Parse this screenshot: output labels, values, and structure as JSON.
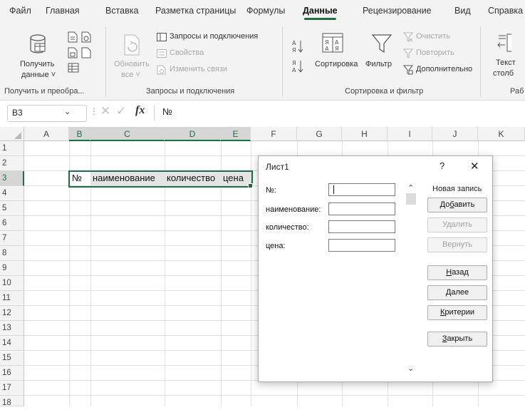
{
  "menu": {
    "tabs": [
      "Файл",
      "Главная",
      "Вставка",
      "Разметка страницы",
      "Формулы",
      "Данные",
      "Рецензирование",
      "Вид",
      "Справка"
    ],
    "active": "Данные"
  },
  "ribbon": {
    "get_data": {
      "line1": "Получить",
      "line2": "данные ˅",
      "group": "Получить и преобра..."
    },
    "refresh": {
      "line1": "Обновить",
      "line2": "все ˅"
    },
    "queries": {
      "connections": "Запросы и подключения",
      "properties": "Свойства",
      "edit_links": "Изменить связи",
      "group": "Запросы и подключения"
    },
    "sort": {
      "sort_label": "Сортировка",
      "filter_label": "Фильтр",
      "clear": "Очистить",
      "reapply": "Повторить",
      "advanced": "Дополнительно",
      "group": "Сортировка и фильтр"
    },
    "text_to_columns": {
      "line1": "Текст",
      "line2": "столб"
    },
    "cut_group": "Раб"
  },
  "formula_bar": {
    "name_box": "B3",
    "fx": "fx",
    "content": "№"
  },
  "sheet": {
    "columns": [
      "A",
      "B",
      "C",
      "D",
      "E",
      "F",
      "G",
      "H",
      "I",
      "J",
      "K"
    ],
    "rows": [
      "1",
      "2",
      "3",
      "4",
      "5",
      "6",
      "7",
      "8",
      "9",
      "10",
      "11",
      "12",
      "13",
      "14",
      "15",
      "16",
      "17",
      "18"
    ],
    "cells": {
      "B3": "№",
      "C3": "наименование",
      "D3": "количество",
      "E3": "цена"
    }
  },
  "dialog": {
    "title": "Лист1",
    "help": "?",
    "close": "✕",
    "record_status": "Новая запись",
    "fields": [
      {
        "label": "№:",
        "value": ""
      },
      {
        "label": "наименование:",
        "value": ""
      },
      {
        "label": "количество:",
        "value": ""
      },
      {
        "label": "цена:",
        "value": ""
      }
    ],
    "buttons": {
      "add": {
        "pre": "До",
        "u": "б",
        "post": "авить"
      },
      "delete": "Удалить",
      "restore": "Вернуть",
      "prev": {
        "u": "Н",
        "post": "азад"
      },
      "next": {
        "u": "Д",
        "post": "алее"
      },
      "criteria": {
        "u": "К",
        "post": "ритерии"
      },
      "close": {
        "u": "З",
        "post": "акрыть"
      }
    }
  }
}
